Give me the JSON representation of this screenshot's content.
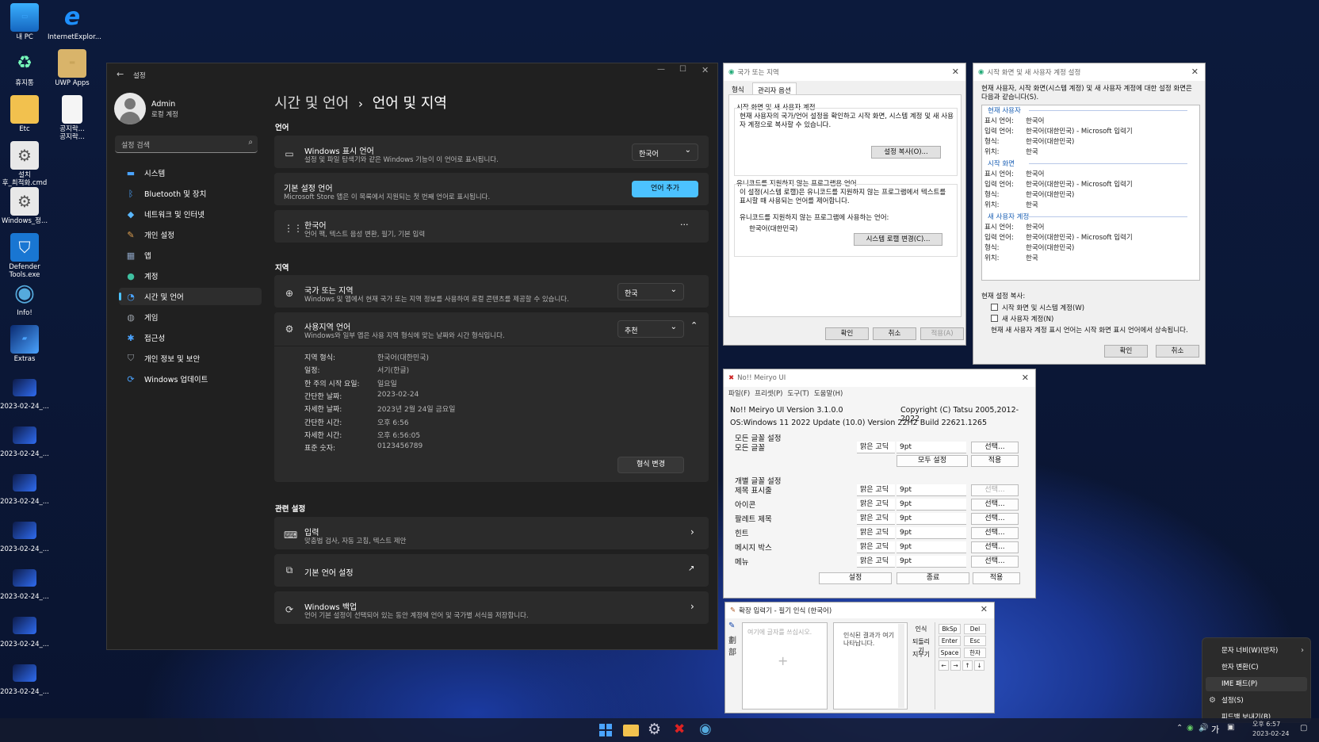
{
  "desktop": {
    "icons": [
      {
        "label": "내 PC",
        "icon": "monitor-icon"
      },
      {
        "label": "InternetExplor...",
        "icon": "ie-icon"
      },
      {
        "label": "휴지통",
        "icon": "recycle-bin-icon"
      },
      {
        "label": "UWP Apps",
        "icon": "box-icon"
      },
      {
        "label": "Etc",
        "icon": "folder-icon"
      },
      {
        "label": "공지락...\n공지락...",
        "icon": "file-icon"
      },
      {
        "label": "설치\n후_최적화.cmd",
        "icon": "gear-file-icon"
      },
      {
        "label": "Windows_정...",
        "icon": "gear-file-icon"
      },
      {
        "label": "Defender\nTools.exe",
        "icon": "shield-icon"
      },
      {
        "label": "Info!",
        "icon": "globe-icon"
      },
      {
        "label": "Extras",
        "icon": "window-icon"
      },
      {
        "label": "2023-02-24_..."
      },
      {
        "label": "2023-02-24_..."
      },
      {
        "label": "2023-02-24_..."
      },
      {
        "label": "2023-02-24_..."
      },
      {
        "label": "2023-02-24_..."
      },
      {
        "label": "2023-02-24_..."
      },
      {
        "label": "2023-02-24_..."
      }
    ]
  },
  "settings": {
    "title": "설정",
    "user": {
      "name": "Admin",
      "type": "로컬 계정"
    },
    "search_placeholder": "설정 검색",
    "nav": [
      {
        "label": "시스템",
        "icon": "monitor-icon",
        "color": "#4aa3ff"
      },
      {
        "label": "Bluetooth 및 장치",
        "icon": "bluetooth-icon",
        "color": "#4aa3ff"
      },
      {
        "label": "네트워크 및 인터넷",
        "icon": "wifi-icon",
        "color": "#5ab8ff"
      },
      {
        "label": "개인 설정",
        "icon": "brush-icon",
        "color": "#e0a050"
      },
      {
        "label": "앱",
        "icon": "apps-icon",
        "color": "#8aa0c0"
      },
      {
        "label": "계정",
        "icon": "person-icon",
        "color": "#3fc0a0"
      },
      {
        "label": "시간 및 언어",
        "icon": "clock-globe-icon",
        "color": "#4aa3ff"
      },
      {
        "label": "게임",
        "icon": "gamepad-icon",
        "color": "#9aa0a8"
      },
      {
        "label": "접근성",
        "icon": "accessibility-icon",
        "color": "#4aa3ff"
      },
      {
        "label": "개인 정보 및 보안",
        "icon": "shield-icon",
        "color": "#9aa0a8"
      },
      {
        "label": "Windows 업데이트",
        "icon": "update-icon",
        "color": "#4aa3ff"
      }
    ],
    "selected_nav": 6,
    "breadcrumb_parent": "시간 및 언어",
    "breadcrumb_sep": "›",
    "page_title": "언어 및 지역",
    "section_language": "언어",
    "display_lang": {
      "title": "Windows 표시 언어",
      "desc": "설정 및 파일 탐색기와 같은 Windows 기능이 이 언어로 표시됩니다.",
      "value": "한국어"
    },
    "preferred_lang": {
      "title": "기본 설정 언어",
      "desc": "Microsoft Store 앱은 이 목록에서 지원되는 첫 번째 언어로 표시됩니다.",
      "button": "언어 추가"
    },
    "korean": {
      "title": "한국어",
      "desc": "언어 팩, 텍스트 음성 변환, 필기, 기본 입력",
      "more": "···"
    },
    "section_region": "지역",
    "country": {
      "title": "국가 또는 지역",
      "desc": "Windows 및 앱에서 현재 국가 또는 지역 정보를 사용하여 로컬 콘텐츠를 제공할 수 있습니다.",
      "value": "한국"
    },
    "regional_format": {
      "title": "사용지역 언어",
      "desc": "Windows와 일부 앱은 사용 지역 형식에 맞는 날짜와 시간 형식입니다.",
      "value": "추천"
    },
    "format_rows": [
      {
        "k": "지역 형식:",
        "v": "한국어(대한민국)"
      },
      {
        "k": "일정:",
        "v": "서기(한글)"
      },
      {
        "k": "한 주의 시작 요일:",
        "v": "일요일"
      },
      {
        "k": "간단한 날짜:",
        "v": "2023-02-24"
      },
      {
        "k": "자세한 날짜:",
        "v": "2023년 2월 24일 금요일"
      },
      {
        "k": "간단한 시간:",
        "v": "오후 6:56"
      },
      {
        "k": "자세한 시간:",
        "v": "오후 6:56:05"
      },
      {
        "k": "표준 숫자:",
        "v": "0123456789"
      }
    ],
    "change_format": "형식 변경",
    "section_related": "관련 설정",
    "input": {
      "title": "입력",
      "desc": "맞춤법 검사, 자동 고침, 텍스트 제안"
    },
    "admin_lang": {
      "title": "기본 언어 설정"
    },
    "backup": {
      "title": "Windows 백업",
      "desc": "언어 기본 설정이 선택되어 있는 동안 계정에 언어 및 국가별 서식을 저장합니다."
    }
  },
  "region_dialog": {
    "title": "국가 또는 지역",
    "tabs": [
      "형식",
      "관리자 옵션"
    ],
    "group1_title": "시작 화면 및 새 사용자 계정",
    "group1_text": "현재 사용자의 국가/언어 설정을 확인하고 시작 화면, 시스템 계정 및 새 사용자 계정으로 복사할 수 있습니다.",
    "copy_button": "설정 복사(O)...",
    "group2_title": "유니코드를 지원하지 않는 프로그램용 언어",
    "group2_text": "이 설정(시스템 로캘)은 유니코드를 지원하지 않는 프로그램에서 텍스트를 표시할 때 사용되는 언어를 제어합니다.",
    "current_label": "유니코드를 지원하지 않는 프로그램에 사용하는 언어:",
    "current_value": "한국어(대한민국)",
    "locale_button": "시스템 로캘 변경(C)...",
    "ok": "확인",
    "cancel": "취소",
    "apply": "적용(A)"
  },
  "copy_dialog": {
    "title": "시작 화면 및 새 사용자 계정 설정",
    "intro": "현재 사용자, 시작 화면(시스템 계정) 및 새 사용자 계정에 대한 설정 화면은 다음과 같습니다(S).",
    "sections": [
      {
        "name": "현재 사용자",
        "rows": [
          {
            "k": "표시 언어:",
            "v": "한국어"
          },
          {
            "k": "입력 언어:",
            "v": "한국어(대한민국) - Microsoft 입력기"
          },
          {
            "k": "형식:",
            "v": "한국어(대한민국)"
          },
          {
            "k": "위치:",
            "v": "한국"
          }
        ]
      },
      {
        "name": "시작 화면",
        "rows": [
          {
            "k": "표시 언어:",
            "v": "한국어"
          },
          {
            "k": "입력 언어:",
            "v": "한국어(대한민국) - Microsoft 입력기"
          },
          {
            "k": "형식:",
            "v": "한국어(대한민국)"
          },
          {
            "k": "위치:",
            "v": "한국"
          }
        ]
      },
      {
        "name": "새 사용자 계정",
        "rows": [
          {
            "k": "표시 언어:",
            "v": "한국어"
          },
          {
            "k": "입력 언어:",
            "v": "한국어(대한민국) - Microsoft 입력기"
          },
          {
            "k": "형식:",
            "v": "한국어(대한민국)"
          },
          {
            "k": "위치:",
            "v": "한국"
          }
        ]
      }
    ],
    "copy_label": "현재 설정 복사:",
    "check1": "시작 화면 및 시스템 계정(W)",
    "check2": "새 사용자 계정(N)",
    "note": "현재 새 사용자 계정 표시 언어는 시작 화면 표시 언어에서 상속됩니다.",
    "ok": "확인",
    "cancel": "취소"
  },
  "meiryo": {
    "title": "No!! Meiryo UI",
    "menu": [
      "파일(F)",
      "프리셋(P)",
      "도구(T)",
      "도움말(H)"
    ],
    "version": "No!! Meiryo UI Version 3.1.0.0",
    "copyright": "Copyright (C) Tatsu 2005,2012-2022",
    "os": "OS:Windows 11 2022 Update (10.0) Version 22H2 Build 22621.1265",
    "all_group": "모든 글꼴 설정",
    "all_label": "모든 글꼴",
    "font": "맑은 고딕",
    "size": "9pt",
    "select": "선택...",
    "set_all": "모두 설정",
    "apply": "적용",
    "indiv_group": "개별 글꼴 설정",
    "items": [
      "제목 표시줄",
      "아이콘",
      "팔레트 제목",
      "힌트",
      "메시지 박스",
      "메뉴"
    ],
    "setup": "설정",
    "exit": "종료"
  },
  "ime_pad": {
    "title": "확장 입력기 - 필기 인식 (한국어)",
    "draw_hint": "여기에 글자를 쓰십시오.",
    "result_hint": "인식된 결과가 여기 나타납니다.",
    "actions": [
      "인식",
      "되돌리기",
      "지우기"
    ],
    "keys": [
      "BkSp",
      "Del",
      "Enter",
      "Esc",
      "Space",
      "한자",
      "←",
      "→",
      "↑",
      "↓"
    ]
  },
  "context_menu": {
    "items": [
      "문자 너비(W)(반자)",
      "한자 변환(C)",
      "IME 패드(P)",
      "설정(S)",
      "피드백 보내기(B)"
    ]
  },
  "taskbar": {
    "date": "2023-02-24",
    "time": "오후 6:57"
  }
}
